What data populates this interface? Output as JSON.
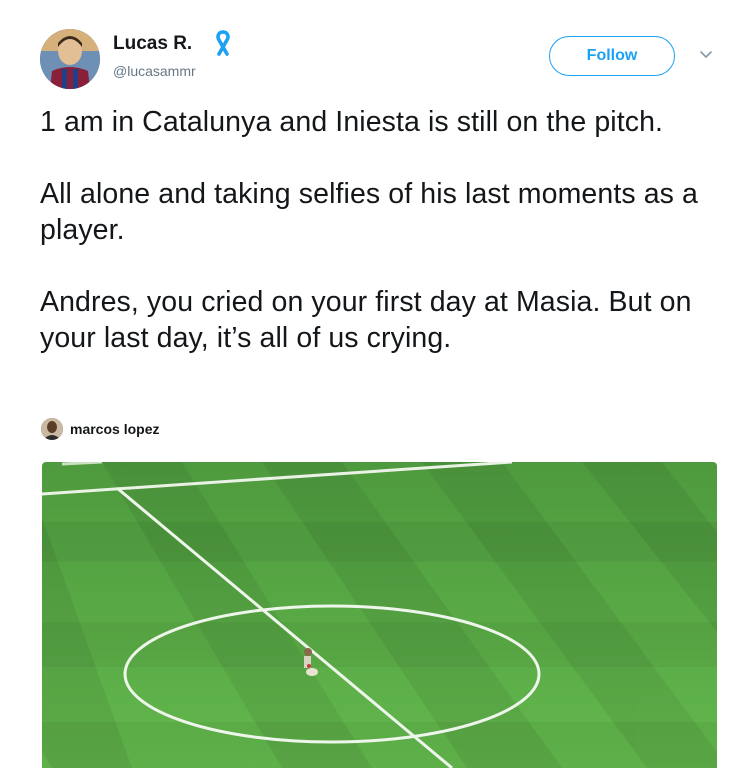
{
  "author": {
    "display_name": "Lucas R.",
    "handle": "@lucasammr",
    "avatar_icon": "avatar-image",
    "badge_icon": "awareness-ribbon-icon",
    "badge_color": "#1da1f2"
  },
  "actions": {
    "follow_label": "Follow",
    "more_icon": "chevron-down-icon",
    "accent_color": "#1da1f2"
  },
  "tweet": {
    "paragraphs": [
      "1 am in Catalunya and Iniesta is still on the pitch.",
      "All alone and taking selfies of his last moments as a player.",
      "Andres, you cried on your first day at Masia. But on your last day, it’s all of us crying."
    ]
  },
  "media": {
    "attribution_name": "marcos lopez",
    "attribution_icon": "user-avatar-icon"
  }
}
